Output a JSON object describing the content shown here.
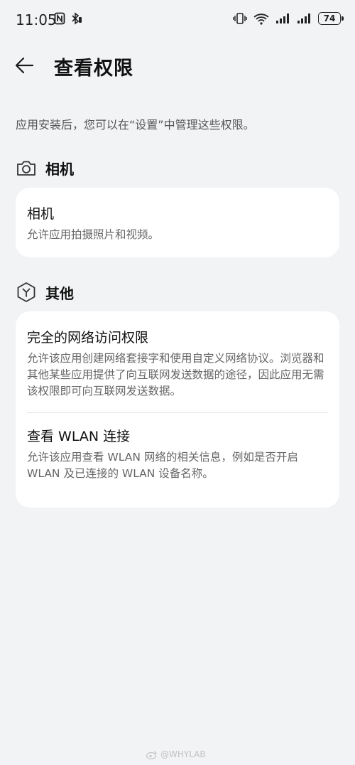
{
  "status_bar": {
    "time": "11:05",
    "battery": "74",
    "icons": [
      "nfc-icon",
      "bluetooth-icon",
      "vibrate-icon",
      "wifi-icon",
      "signal-icon",
      "signal-icon-2"
    ]
  },
  "header": {
    "title": "查看权限"
  },
  "intro_text": "应用安装后，您可以在“设置”中管理这些权限。",
  "sections": [
    {
      "label": "相机",
      "icon": "camera-icon",
      "items": [
        {
          "title": "相机",
          "description": "允许应用拍摄照片和视频。"
        }
      ]
    },
    {
      "label": "其他",
      "icon": "hexagon-icon",
      "items": [
        {
          "title": "完全的网络访问权限",
          "description": "允许该应用创建网络套接字和使用自定义网络协议。浏览器和其他某些应用提供了向互联网发送数据的途径，因此应用无需该权限即可向互联网发送数据。"
        },
        {
          "title": "查看 WLAN 连接",
          "description": "允许该应用查看 WLAN 网络的相关信息，例如是否开启 WLAN 及已连接的 WLAN 设备名称。"
        }
      ]
    }
  ],
  "watermark": "@WHYLAB",
  "colors": {
    "background": "#f1f3f5",
    "card": "#ffffff",
    "text": "#111111",
    "secondary_text": "#666666"
  }
}
